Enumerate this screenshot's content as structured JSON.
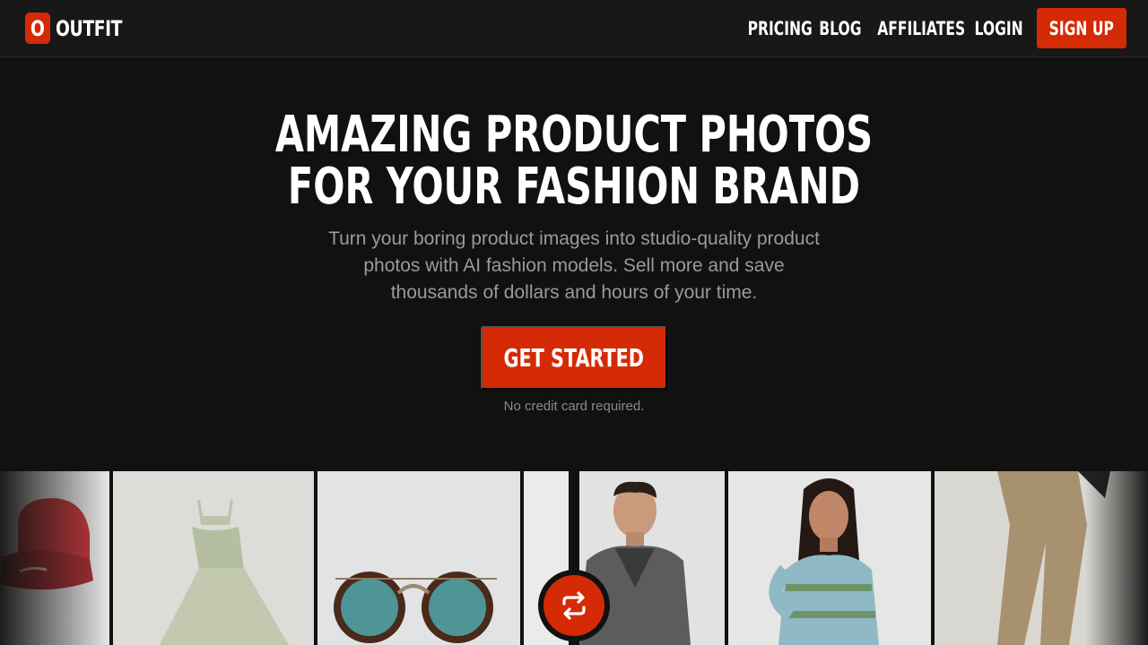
{
  "brand": {
    "logo_letter": "O",
    "name": "OUTFIT",
    "accent_color": "#d42a05"
  },
  "nav": {
    "links": [
      "PRICING",
      "BLOG",
      "AFFILIATES",
      "LOGIN"
    ],
    "signup_label": "SIGN UP"
  },
  "hero": {
    "title_line1": "AMAZING PRODUCT PHOTOS",
    "title_line2": "FOR YOUR FASHION BRAND",
    "subtitle": "Turn your boring product images into studio-quality product photos with AI fashion models. Sell more and save thousands of dollars and hours of your time.",
    "cta_label": "GET STARTED",
    "cta_note": "No credit card required."
  },
  "gallery": {
    "items": [
      "red-cap-product-photo",
      "sage-dress-product-photo",
      "sunglasses-product-photo",
      "white-product-photo",
      "man-wool-coat-model-photo",
      "woman-knit-sweater-model-photo",
      "khaki-trousers-model-photo"
    ],
    "swap_icon": "swap-arrows-icon"
  }
}
